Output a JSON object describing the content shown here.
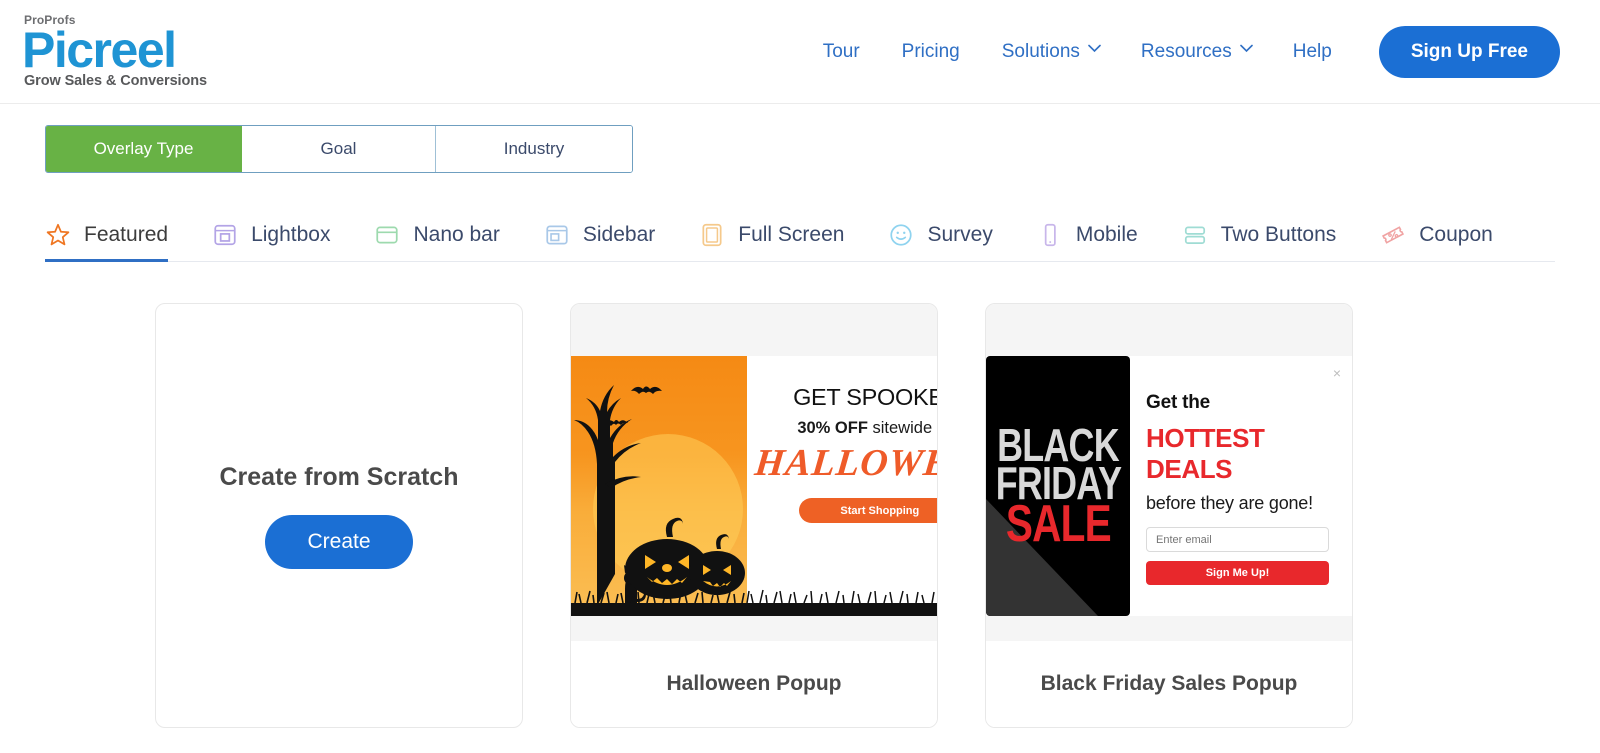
{
  "header": {
    "logo": {
      "top": "ProProfs",
      "main": "Picreel",
      "tagline": "Grow Sales & Conversions"
    },
    "nav": [
      {
        "label": "Tour",
        "has_chevron": false
      },
      {
        "label": "Pricing",
        "has_chevron": false
      },
      {
        "label": "Solutions",
        "has_chevron": true
      },
      {
        "label": "Resources",
        "has_chevron": true
      },
      {
        "label": "Help",
        "has_chevron": false
      }
    ],
    "signup_label": "Sign Up Free",
    "accent_blue": "#1b6fd4"
  },
  "segmented": {
    "active_index": 0,
    "active_color": "#68b245",
    "options": [
      {
        "label": "Overlay Type"
      },
      {
        "label": "Goal"
      },
      {
        "label": "Industry"
      }
    ]
  },
  "tabs": {
    "active_index": 0,
    "underline_color": "#2f6fc4",
    "items": [
      {
        "label": "Featured",
        "icon": "star-icon",
        "icon_color": "#ef7622"
      },
      {
        "label": "Lightbox",
        "icon": "lightbox-icon",
        "icon_color": "#b3a4e6"
      },
      {
        "label": "Nano bar",
        "icon": "nano-bar-icon",
        "icon_color": "#9ddaae"
      },
      {
        "label": "Sidebar",
        "icon": "sidebar-icon",
        "icon_color": "#a9c8e8"
      },
      {
        "label": "Full Screen",
        "icon": "full-screen-icon",
        "icon_color": "#f5c98b"
      },
      {
        "label": "Survey",
        "icon": "survey-smiley-icon",
        "icon_color": "#8fd3ef"
      },
      {
        "label": "Mobile",
        "icon": "mobile-icon",
        "icon_color": "#c8b6ea"
      },
      {
        "label": "Two Buttons",
        "icon": "two-buttons-icon",
        "icon_color": "#9fdcd4"
      },
      {
        "label": "Coupon",
        "icon": "coupon-icon",
        "icon_color": "#f0a3a3"
      }
    ]
  },
  "cards": {
    "scratch": {
      "title": "Create from Scratch",
      "button_label": "Create"
    },
    "halloween": {
      "title": "Halloween Popup",
      "popup": {
        "heading": "GET SPOOKED!",
        "sub_bold": "30% OFF",
        "sub_rest": " sitewide this",
        "script_word": "HALLOWEEN",
        "cta_label": "Start Shopping",
        "cta_color": "#ee6125"
      }
    },
    "blackfriday": {
      "title": "Black Friday Sales Popup",
      "popup": {
        "art_line1": "BLACK",
        "art_line2": "FRIDAY",
        "art_line3": "SALE",
        "line1": "Get the",
        "line2": "HOTTEST DEALS",
        "line3": "before they are gone!",
        "email_placeholder": "Enter email",
        "cta_label": "Sign Me Up!",
        "cta_color": "#e8282c",
        "close_glyph": "×"
      }
    }
  }
}
